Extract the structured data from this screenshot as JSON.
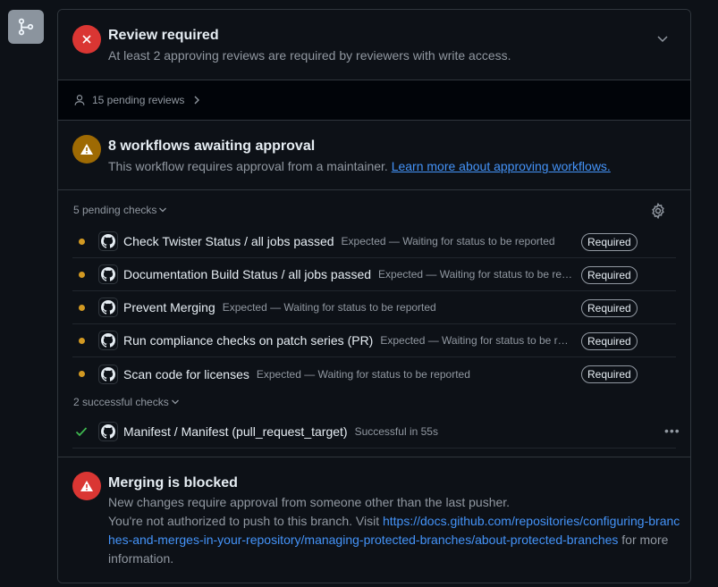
{
  "colors": {
    "background": "#0d1117",
    "border": "#30363d",
    "danger": "#da3633",
    "attention": "#9e6a03",
    "pending_dot": "#d29922",
    "success": "#3fb950",
    "link": "#4493f8",
    "muted_text": "#9198a1"
  },
  "sidebar": {
    "icon": "git-branch-icon"
  },
  "review": {
    "title": "Review required",
    "subtitle": "At least 2 approving reviews are required by reviewers with write access.",
    "pending_reviews_label": "15 pending reviews"
  },
  "workflows": {
    "title": "8 workflows awaiting approval",
    "subtitle_text": "This workflow requires approval from a maintainer.",
    "link_text": "Learn more about approving workflows."
  },
  "checks": {
    "pending_toggle_label": "5 pending checks",
    "pending": [
      {
        "name": "Check Twister Status / all jobs passed",
        "desc": "Expected — Waiting for status to be reported",
        "badge": "Required"
      },
      {
        "name": "Documentation Build Status / all jobs passed",
        "desc": "Expected — Waiting for status to be reported",
        "badge": "Required"
      },
      {
        "name": "Prevent Merging",
        "desc": "Expected — Waiting for status to be reported",
        "badge": "Required"
      },
      {
        "name": "Run compliance checks on patch series (PR)",
        "desc": "Expected — Waiting for status to be reported",
        "badge": "Required"
      },
      {
        "name": "Scan code for licenses",
        "desc": "Expected — Waiting for status to be reported",
        "badge": "Required"
      }
    ],
    "successful_toggle_label": "2 successful checks",
    "successful": [
      {
        "name": "Manifest / Manifest (pull_request_target)",
        "desc": "Successful in 55s",
        "menu": "•••"
      }
    ]
  },
  "merging": {
    "title": "Merging is blocked",
    "line1": "New changes require approval from someone other than the last pusher.",
    "line2_prefix": "You're not authorized to push to this branch. Visit",
    "url": "https://docs.github.com/repositories/configuring-branches-and-merges-in-your-repository/managing-protected-branches/about-protected-branches",
    "line2_suffix": "for more information."
  }
}
